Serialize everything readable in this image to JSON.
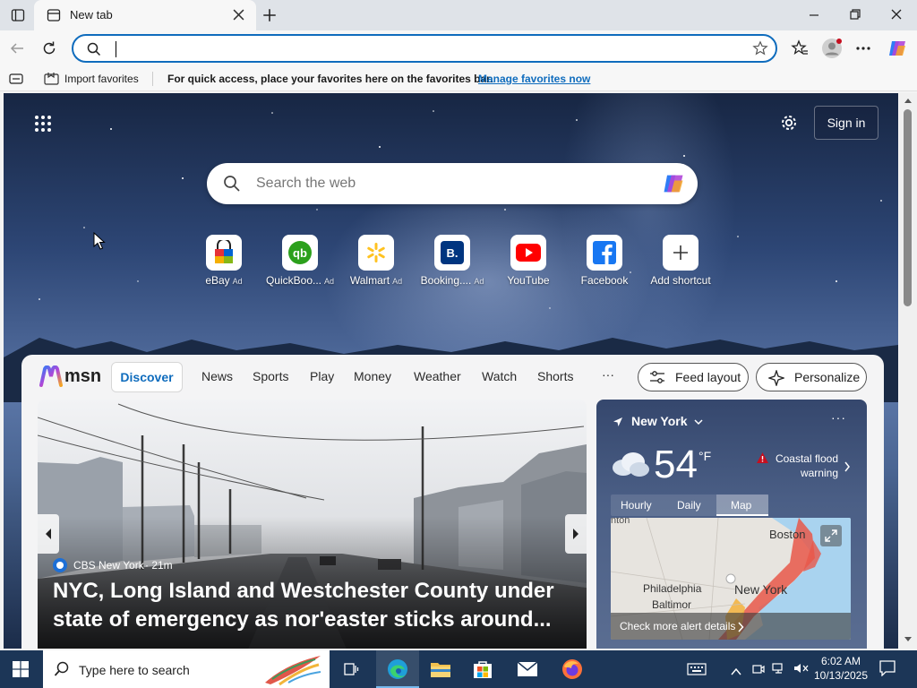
{
  "browser": {
    "tab_title": "New tab",
    "address_value": "",
    "favorites_bar": {
      "import_label": "Import favorites",
      "message": "For quick access, place your favorites here on the favorites bar.",
      "manage_link": "Manage favorites now"
    }
  },
  "newtab": {
    "sign_in_label": "Sign in",
    "search_placeholder": "Search the web",
    "shortcuts": [
      {
        "label": "eBay",
        "ad": "Ad",
        "icon": "ebay-icon"
      },
      {
        "label": "QuickBoo...",
        "ad": "Ad",
        "icon": "quickbooks-icon"
      },
      {
        "label": "Walmart",
        "ad": "Ad",
        "icon": "walmart-icon"
      },
      {
        "label": "Booking....",
        "ad": "Ad",
        "icon": "booking-icon"
      },
      {
        "label": "YouTube",
        "ad": "",
        "icon": "youtube-icon"
      },
      {
        "label": "Facebook",
        "ad": "",
        "icon": "facebook-icon"
      },
      {
        "label": "Add shortcut",
        "ad": "",
        "icon": "plus-icon"
      }
    ]
  },
  "msn": {
    "brand": "msn",
    "nav": [
      "Discover",
      "News",
      "Sports",
      "Play",
      "Money",
      "Weather",
      "Watch",
      "Shorts"
    ],
    "more": "···",
    "feed_layout": "Feed layout",
    "personalize": "Personalize",
    "hero": {
      "source": "CBS New York",
      "age": "· 21m",
      "headline_line1": "NYC, Long Island and Westchester County under",
      "headline_line2": "state of emergency as nor'easter sticks around..."
    },
    "weather": {
      "location": "New York",
      "temp": "54",
      "unit": "°F",
      "alert_line1": "Coastal flood",
      "alert_line2": "warning",
      "tabs": [
        "Hourly",
        "Daily",
        "Map"
      ],
      "map_labels": [
        "Boston",
        "Philadelphia",
        "New York",
        "Baltimor",
        "nton"
      ],
      "map_cta": "Check more alert details"
    }
  },
  "taskbar": {
    "search_placeholder": "Type here to search",
    "time": "6:02 AM",
    "date": "10/13/2025"
  },
  "colors": {
    "accent": "#0f6cbd",
    "taskbar": "#1c3657",
    "alert": "#c50f1f"
  }
}
